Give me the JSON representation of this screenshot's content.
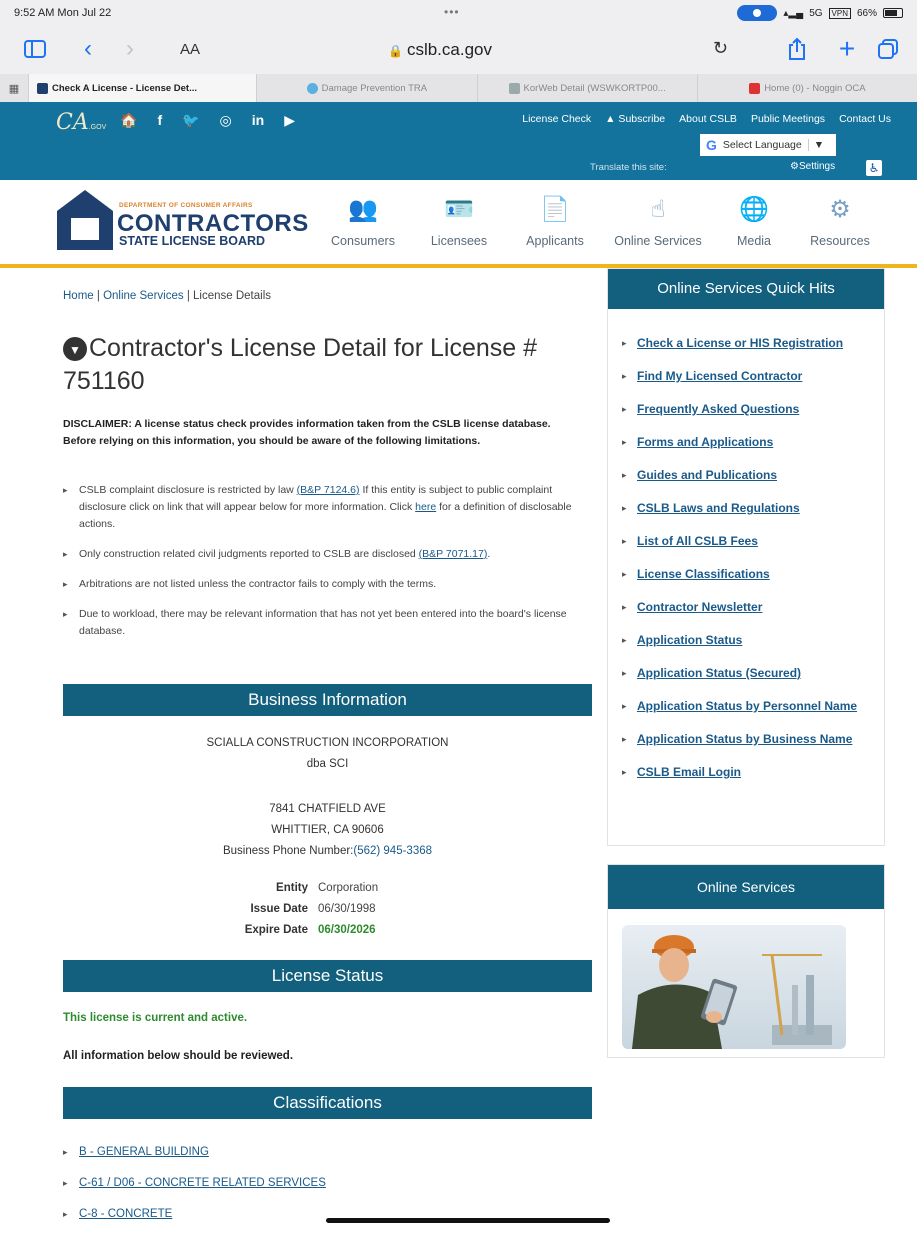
{
  "status_bar": {
    "time": "9:52 AM  Mon Jul 22",
    "dots": "•••",
    "network": "5G",
    "vpn": "VPN",
    "battery": "66%"
  },
  "browser": {
    "text_size": "AA",
    "url": "cslb.ca.gov"
  },
  "tabs": [
    {
      "label": "Check A License - License Det...",
      "active": true
    },
    {
      "label": "Damage Prevention TRA",
      "active": false
    },
    {
      "label": "KorWeb Detail (WSWKORTP00...",
      "active": false
    },
    {
      "label": "Home (0) - Noggin OCA",
      "active": false
    }
  ],
  "header": {
    "ca_logo": "CA",
    "ca_logo_sub": ".GOV",
    "social": [
      "🏠",
      "f",
      "🐦",
      "◎",
      "in",
      "▶"
    ],
    "links": [
      "License Check",
      "▲ Subscribe",
      "About CSLB",
      "Public Meetings",
      "Contact Us"
    ],
    "language": "Select Language",
    "translate": "Translate this site:",
    "settings": "⚙Settings",
    "access": "♿"
  },
  "brand": {
    "dept": "DEPARTMENT OF CONSUMER AFFAIRS",
    "name": "CONTRACTORS",
    "board": "STATE LICENSE BOARD",
    "nav": [
      {
        "label": "Consumers",
        "icon": "people-icon",
        "glyph": "👥"
      },
      {
        "label": "Licensees",
        "icon": "badge-icon",
        "glyph": "🪪"
      },
      {
        "label": "Applicants",
        "icon": "document-icon",
        "glyph": "📄"
      },
      {
        "label": "Online Services",
        "icon": "hand-pointer-icon",
        "glyph": "☝"
      },
      {
        "label": "Media",
        "icon": "globe-icon",
        "glyph": "🌐"
      },
      {
        "label": "Resources",
        "icon": "network-icon",
        "glyph": "⚙"
      }
    ]
  },
  "breadcrumb": {
    "home": "Home",
    "online_services": "Online Services",
    "current": "License Details"
  },
  "page": {
    "title": "Contractor's License Detail for License # 751160",
    "disclaimer": "DISCLAIMER: A license status check provides information taken from the CSLB license database. Before relying on this information, you should be aware of the following limitations.",
    "bullets": {
      "b1_pre": "CSLB complaint disclosure is restricted by law ",
      "b1_link": "(B&P 7124.6)",
      "b1_mid": " If this entity is subject to public complaint disclosure click on link that will appear below for more information. Click ",
      "b1_here": "here",
      "b1_post": " for a definition of disclosable actions.",
      "b2_pre": "Only construction related civil judgments reported to CSLB are disclosed ",
      "b2_link": "(B&P 7071.17)",
      "b2_post": ".",
      "b3": "Arbitrations are not listed unless the contractor fails to comply with the terms.",
      "b4": "Due to workload, there may be relevant information that has not yet been entered into the board's license database."
    }
  },
  "business": {
    "heading": "Business Information",
    "name": "SCIALLA CONSTRUCTION INCORPORATION",
    "dba": "dba SCI",
    "street": "7841 CHATFIELD AVE",
    "city": "WHITTIER, CA 90606",
    "phone_label": "Business Phone Number:",
    "phone": "(562) 945-3368",
    "entity_label": "Entity",
    "entity": "Corporation",
    "issue_label": "Issue Date",
    "issue": "06/30/1998",
    "expire_label": "Expire Date",
    "expire": "06/30/2026"
  },
  "license_status": {
    "heading": "License Status",
    "status": "This license is current and active.",
    "note": "All information below should be reviewed."
  },
  "classifications": {
    "heading": "Classifications",
    "items": [
      "B - GENERAL BUILDING",
      "C-61 / D06 - CONCRETE RELATED SERVICES",
      "C-8 - CONCRETE"
    ]
  },
  "sidebar": {
    "quick_hits_title": "Online Services Quick Hits",
    "quick_hits": [
      "Check a License or HIS Registration",
      "Find My Licensed Contractor",
      "Frequently Asked Questions",
      "Forms and Applications",
      "Guides and Publications",
      "CSLB Laws and Regulations",
      "List of All CSLB Fees",
      "License Classifications",
      "Contractor Newsletter",
      "Application Status",
      "Application Status (Secured)",
      "Application Status by Personnel Name",
      "Application Status by Business Name",
      "CSLB Email Login"
    ],
    "online_services_title": "Online Services"
  },
  "colors": {
    "header_blue": "#13739d",
    "section_blue": "#12607e",
    "gold_rule": "#f1b51c",
    "active_green": "#2e8b2e",
    "link": "#1a5a8a"
  }
}
